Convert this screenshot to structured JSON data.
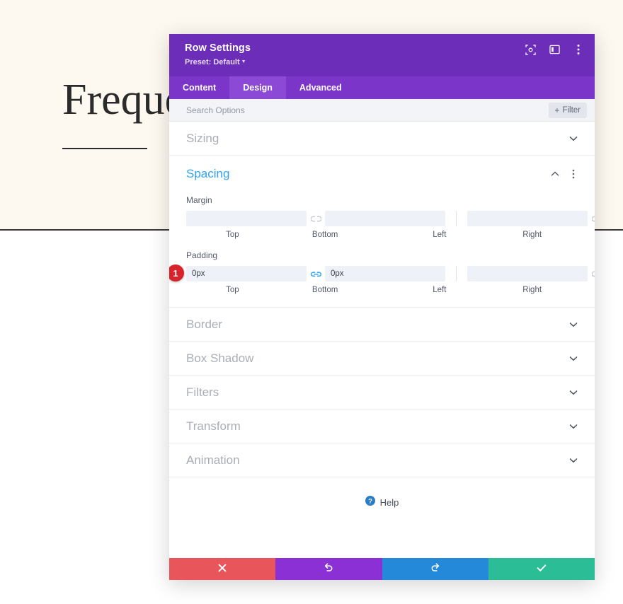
{
  "background": {
    "hero_title": "Frequen",
    "bg_color": "#fdf9f1"
  },
  "modal": {
    "title": "Row Settings",
    "preset_label": "Preset: Default",
    "header_icons": [
      {
        "name": "focus-target-icon"
      },
      {
        "name": "split-panel-icon"
      },
      {
        "name": "more-options-icon"
      }
    ],
    "tabs": [
      {
        "label": "Content",
        "active": false
      },
      {
        "label": "Design",
        "active": true
      },
      {
        "label": "Advanced",
        "active": false
      }
    ],
    "search": {
      "placeholder": "Search Options",
      "value": "",
      "filter_label": "Filter",
      "filter_plus": "+"
    },
    "sections": [
      {
        "label": "Sizing",
        "open": false
      },
      {
        "label": "Spacing",
        "open": true
      },
      {
        "label": "Border",
        "open": false
      },
      {
        "label": "Box Shadow",
        "open": false
      },
      {
        "label": "Filters",
        "open": false
      },
      {
        "label": "Transform",
        "open": false
      },
      {
        "label": "Animation",
        "open": false
      }
    ],
    "spacing": {
      "title": "Spacing",
      "margin": {
        "label": "Margin",
        "top": {
          "value": "",
          "sublabel": "Top"
        },
        "bottom": {
          "value": "",
          "sublabel": "Bottom"
        },
        "left": {
          "value": "",
          "sublabel": "Left"
        },
        "right": {
          "value": "",
          "sublabel": "Right"
        },
        "link_tb_state": "unlinked",
        "link_lr_state": "unlinked"
      },
      "padding": {
        "label": "Padding",
        "badge": "1",
        "top": {
          "value": "0px",
          "sublabel": "Top"
        },
        "bottom": {
          "value": "0px",
          "sublabel": "Bottom"
        },
        "left": {
          "value": "",
          "sublabel": "Left"
        },
        "right": {
          "value": "",
          "sublabel": "Right"
        },
        "link_tb_state": "linked",
        "link_lr_state": "unlinked"
      }
    },
    "help": {
      "label": "Help",
      "icon": "help-circle-icon"
    },
    "footer": [
      {
        "name": "cancel-button",
        "icon": "close-icon",
        "color": "#e8555a"
      },
      {
        "name": "undo-button",
        "icon": "undo-icon",
        "color": "#8a30d4"
      },
      {
        "name": "redo-button",
        "icon": "redo-icon",
        "color": "#2389d8"
      },
      {
        "name": "save-button",
        "icon": "check-icon",
        "color": "#2bbd96"
      }
    ]
  },
  "colors": {
    "header_purple": "#6c2eb9",
    "tabs_purple": "#7c35c9",
    "tab_active_purple": "#8b49d6",
    "accent_blue": "#2ea3f2",
    "badge_red": "#d8232a"
  }
}
